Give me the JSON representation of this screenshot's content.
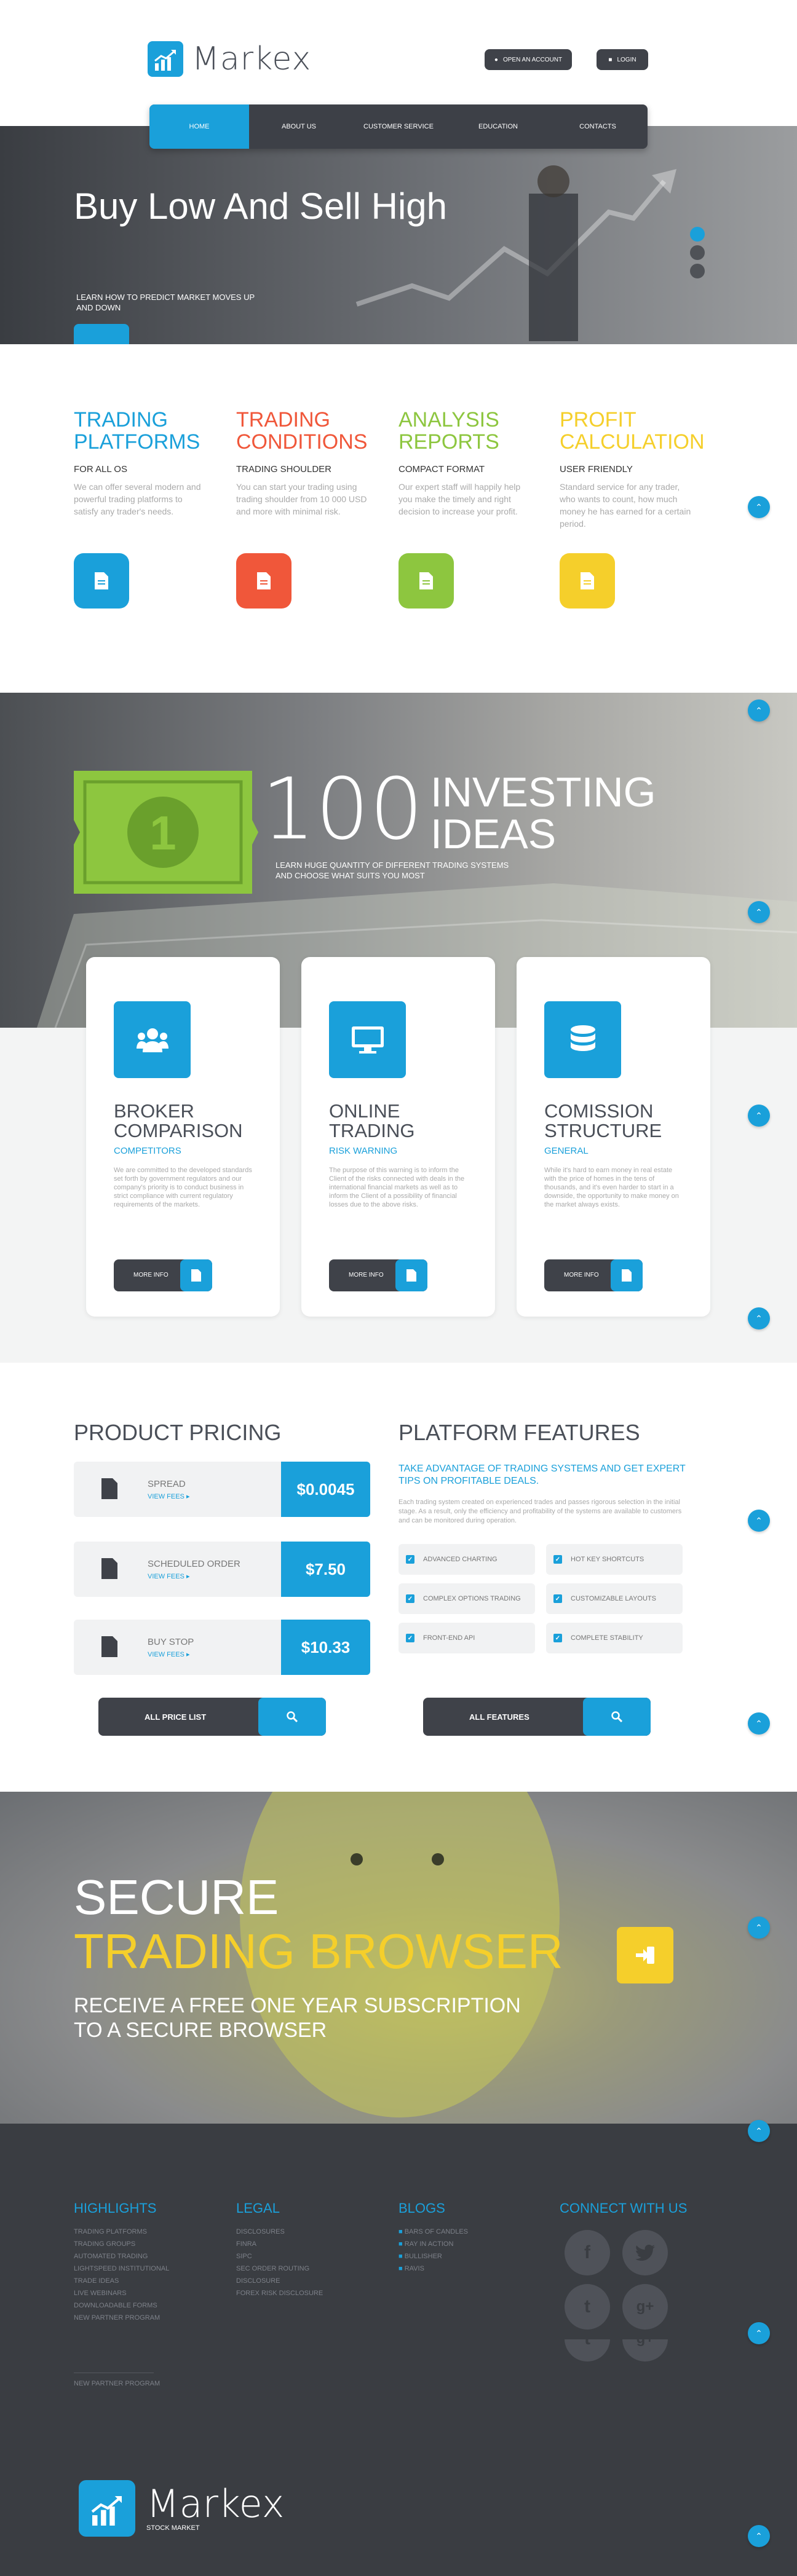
{
  "brand": {
    "name": "Markex",
    "tagline": "STOCK MARKET",
    "accent": "#1aa0da"
  },
  "header": {
    "open_account": "OPEN AN ACCOUNT",
    "login": "LOGIN"
  },
  "nav": {
    "items": [
      "HOME",
      "ABOUT US",
      "CUSTOMER SERVICE",
      "EDUCATION",
      "CONTACTS"
    ],
    "active": "HOME"
  },
  "hero": {
    "title": "Buy Low And Sell High",
    "subtitle": "LEARN HOW TO PREDICT MARKET MOVES UP AND DOWN"
  },
  "features": [
    {
      "title": "TRADING PLATFORMS",
      "sub": "FOR ALL OS",
      "text": "We can offer several modern and powerful trading platforms to satisfy any trader's needs.",
      "color": "#1aa0da"
    },
    {
      "title": "TRADING CONDITIONS",
      "sub": "TRADING SHOULDER",
      "text": "You can start your trading using trading shoulder from 10 000 USD and more with minimal risk.",
      "color": "#f0573a"
    },
    {
      "title": "ANALYSIS REPORTS",
      "sub": "COMPACT FORMAT",
      "text": "Our expert staff will happily help you make the timely and right decision to increase your profit.",
      "color": "#8dc63f"
    },
    {
      "title": "PROFIT CALCULATION",
      "sub": "USER FRIENDLY",
      "text": "Standard service for any trader, who wants to count, how much money he has earned for a certain period.",
      "color": "#f5cf2b"
    }
  ],
  "ideas": {
    "number": "100",
    "title_line1": "INVESTING",
    "title_line2": "IDEAS",
    "sub": "LEARN HUGE QUANTITY OF DIFFERENT TRADING SYSTEMS AND CHOOSE WHAT SUITS YOU MOST"
  },
  "cards": [
    {
      "title": "BROKER COMPARISON",
      "sub": "COMPETITORS",
      "text": "We are committed to the developed standards set forth by government regulators and our company's priority is to conduct business in strict compliance with current regulatory requirements of the markets.",
      "btn": "MORE INFO",
      "icon": "users-icon"
    },
    {
      "title": "ONLINE TRADING",
      "sub": "RISK WARNING",
      "text": "The purpose of this warning is to inform the Client of the risks connected with deals in the international financial markets as well as to inform the Client of a possibility of financial losses due to the above risks.",
      "btn": "MORE INFO",
      "icon": "monitor-icon"
    },
    {
      "title": "COMISSION STRUCTURE",
      "sub": "GENERAL",
      "text": "While it's hard to earn money in real estate with the price of homes in the tens of thousands, and it's even harder to start in a downside, the opportunity to make money on the market always exists.",
      "btn": "MORE INFO",
      "icon": "database-icon"
    }
  ],
  "pricing": {
    "title": "PRODUCT PRICING",
    "link": "VIEW FEES",
    "rows": [
      {
        "label": "SPREAD",
        "value": "$0.0045"
      },
      {
        "label": "SCHEDULED ORDER",
        "value": "$7.50"
      },
      {
        "label": "BUY STOP",
        "value": "$10.33"
      }
    ],
    "btn": "ALL PRICE LIST"
  },
  "platform": {
    "title": "PLATFORM FEATURES",
    "lead": "TAKE ADVANTAGE OF TRADING SYSTEMS AND GET EXPERT TIPS ON PROFITABLE DEALS.",
    "text": "Each trading system created on experienced trades and passes rigorous selection in the initial stage. As a result, only the efficiency and profitability of the systems are available to customers and can be monitored during operation.",
    "checks": [
      "ADVANCED CHARTING",
      "HOT KEY SHORTCUTS",
      "COMPLEX OPTIONS TRADING",
      "CUSTOMIZABLE LAYOUTS",
      "FRONT-END API",
      "COMPLETE STABILITY"
    ],
    "btn": "ALL FEATURES"
  },
  "secure": {
    "line1": "SECURE",
    "line2": "TRADING BROWSER",
    "sub": "RECEIVE A FREE ONE YEAR SUBSCRIPTION TO A SECURE BROWSER"
  },
  "footer": {
    "highlights": {
      "title": "HIGHLIGHTS",
      "links": [
        "TRADING PLATFORMS",
        "TRADING GROUPS",
        "AUTOMATED TRADING",
        "LIGHTSPEED INSTITUTIONAL",
        "TRADE IDEAS",
        "LIVE WEBINARS",
        "DOWNLOADABLE FORMS",
        "NEW PARTNER PROGRAM"
      ],
      "extra": "NEW PARTNER PROGRAM"
    },
    "legal": {
      "title": "LEGAL",
      "links": [
        "DISCLOSURES",
        "FINRA",
        "SIPC",
        "SEC ORDER ROUTING",
        "DISCLOSURE",
        "FOREX RISK DISCLOSURE"
      ]
    },
    "blogs": {
      "title": "BLOGS",
      "links": [
        "BARS OF CANDLES",
        "RAY IN ACTION",
        "BULLISHER",
        "RAVIS"
      ]
    },
    "connect": {
      "title": "CONNECT WITH US",
      "icons": [
        "facebook-icon",
        "twitter-icon",
        "tumblr-icon",
        "google-plus-icon"
      ]
    }
  }
}
